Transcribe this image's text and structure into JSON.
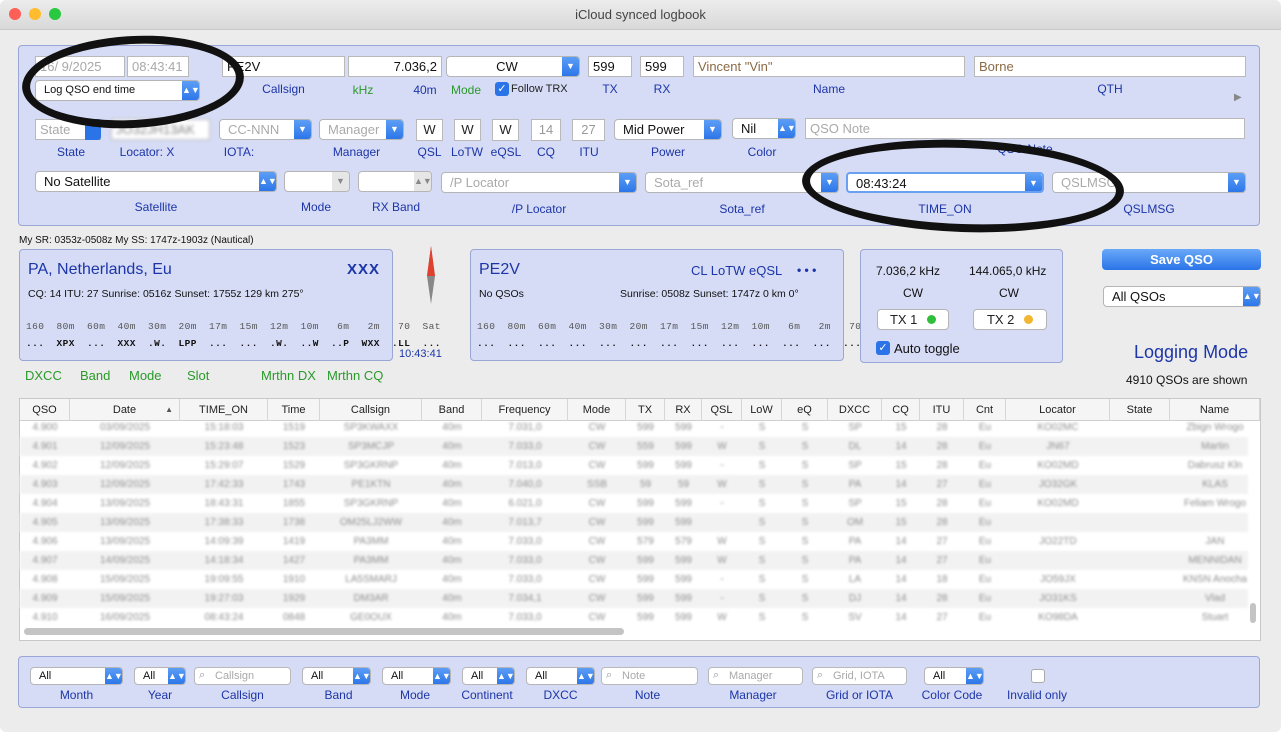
{
  "window": {
    "title": "iCloud synced logbook"
  },
  "entry": {
    "date": "16/ 9/2025",
    "time": "08:43:41",
    "log_end_time": "Log QSO end time",
    "callsign": "PE2V",
    "callsign_label": "Callsign",
    "frequency": "7.036,2",
    "khz_label": "kHz",
    "band_label": "40m",
    "mode": "CW",
    "mode_label": "Mode",
    "follow_trx": "Follow TRX",
    "tx_rst": "599",
    "tx_label": "TX",
    "rx_rst": "599",
    "rx_label": "RX",
    "name": "Vincent \"Vin\"",
    "name_label": "Name",
    "qth": "Borne",
    "qth_label": "QTH",
    "state_placeholder": "State",
    "state_label": "State",
    "locator": "JO32JH13AK",
    "locator_label": "Locator: X",
    "iota_placeholder": "CC-NNN",
    "iota_label": "IOTA:",
    "manager_placeholder": "Manager",
    "manager_label": "Manager",
    "qsl": "W",
    "qsl_label": "QSL",
    "lotw": "W",
    "lotw_label": "LoTW",
    "eqsl": "W",
    "eqsl_label": "eQSL",
    "cq": "14",
    "cq_label": "CQ",
    "itu": "27",
    "itu_label": "ITU",
    "power": "Mid Power",
    "power_label": "Power",
    "color": "Nil",
    "color_label": "Color",
    "qso_note_placeholder": "QSO Note",
    "qso_note_label": "QSO Note",
    "satellite": "No Satellite",
    "satellite_label": "Satellite",
    "sat_mode_label": "Mode",
    "rx_band_label": "RX Band",
    "p_locator_placeholder": "/P Locator",
    "p_locator_label": "/P Locator",
    "sota_placeholder": "Sota_ref",
    "sota_label": "Sota_ref",
    "time_on": "08:43:24",
    "time_on_label": "TIME_ON",
    "qslmsg_placeholder": "QSLMSG",
    "qslmsg_label": "QSLMSG"
  },
  "sun": "My SR: 0353z-0508z  My SS: 1747z-1903z (Nautical)",
  "dxcc_card": {
    "entity": "PA, Netherlands, Eu",
    "flags": "XXX",
    "info": "CQ: 14  ITU: 27  Sunrise: 0516z  Sunset: 1755z  129 km  275°",
    "bands": "160  80m  60m  40m  30m  20m  17m  15m  12m  10m   6m   2m   70  Sat",
    "status": "...  XPX  ...  XXX  .W.  LPP  ...  ...  .W.  ..W  ..P  WXX  .LL  ..."
  },
  "clock": "10:43:41",
  "call_card": {
    "callsign": "PE2V",
    "services": "CL LoTW eQSL",
    "dots": "• • •",
    "qsos": "No QSOs",
    "info": "Sunrise: 0508z  Sunset: 1747z  0 km  0°",
    "bands": "160  80m  60m  40m  30m  20m  17m  15m  12m  10m   6m   2m   70  Sat",
    "status": "...  ...  ...  ...  ...  ...  ...  ...  ...  ...  ...  ...  ...  ..."
  },
  "links": [
    "DXCC",
    "Band",
    "Mode",
    "Slot",
    "Mrthn DX",
    "Mrthn CQ"
  ],
  "trx": {
    "tx1_freq": "7.036,2 kHz",
    "tx2_freq": "144.065,0 kHz",
    "tx1_mode": "CW",
    "tx2_mode": "CW",
    "tx1": "TX 1",
    "tx2": "TX 2",
    "auto_toggle": "Auto toggle"
  },
  "save": "Save QSO",
  "filter_view": "All QSOs",
  "logging_mode": "Logging Mode",
  "count": "4910 QSOs are shown",
  "table": {
    "headers": [
      "QSO",
      "Date",
      "TIME_ON",
      "Time",
      "Callsign",
      "Band",
      "Frequency",
      "Mode",
      "TX",
      "RX",
      "QSL",
      "LoW",
      "eQ",
      "DXCC",
      "CQ",
      "ITU",
      "Cnt",
      "Locator",
      "State",
      "Name"
    ],
    "rows": [
      [
        "4.900",
        "03/09/2025",
        "15:18:03",
        "1519",
        "SP3KWAXX",
        "40m",
        "7.031,0",
        "CW",
        "599",
        "599",
        "-",
        "S",
        "S",
        "SP",
        "15",
        "28",
        "Eu",
        "KO02MC",
        "",
        "Zbign Wrogo"
      ],
      [
        "4.901",
        "12/09/2025",
        "15:23:48",
        "1523",
        "SP3MCJP",
        "40m",
        "7.033,0",
        "CW",
        "559",
        "599",
        "W",
        "S",
        "S",
        "DL",
        "14",
        "28",
        "Eu",
        "JN67",
        "",
        "Martin"
      ],
      [
        "4.902",
        "12/09/2025",
        "15:29:07",
        "1529",
        "SP3GKRNP",
        "40m",
        "7.013,0",
        "CW",
        "599",
        "599",
        "-",
        "S",
        "S",
        "SP",
        "15",
        "28",
        "Eu",
        "KO02MD",
        "",
        "Dabrusz Kln"
      ],
      [
        "4.903",
        "12/09/2025",
        "17:42:33",
        "1743",
        "PE1KTN",
        "40m",
        "7.040,0",
        "SSB",
        "59",
        "59",
        "W",
        "S",
        "S",
        "PA",
        "14",
        "27",
        "Eu",
        "JO32GK",
        "",
        "KLAS"
      ],
      [
        "4.904",
        "13/09/2025",
        "18:43:31",
        "1855",
        "SP3GKRNP",
        "40m",
        "6.021,0",
        "CW",
        "599",
        "599",
        "-",
        "S",
        "S",
        "SP",
        "15",
        "28",
        "Eu",
        "KO02MD",
        "",
        "Feliam Wrogo"
      ],
      [
        "4.905",
        "13/09/2025",
        "17:38:33",
        "1738",
        "OM25LJ2WW",
        "40m",
        "7.013,7",
        "CW",
        "599",
        "599",
        "",
        "S",
        "S",
        "OM",
        "15",
        "28",
        "Eu",
        "",
        "",
        ""
      ],
      [
        "4.906",
        "13/09/2025",
        "14:09:39",
        "1419",
        "PA3MM",
        "40m",
        "7.033,0",
        "CW",
        "579",
        "579",
        "W",
        "S",
        "S",
        "PA",
        "14",
        "27",
        "Eu",
        "JO22TD",
        "",
        "JAN"
      ],
      [
        "4.907",
        "14/09/2025",
        "14:18:34",
        "1427",
        "PA3MM",
        "40m",
        "7.033,0",
        "CW",
        "599",
        "599",
        "W",
        "S",
        "S",
        "PA",
        "14",
        "27",
        "Eu",
        "",
        "",
        "MENNIDAN"
      ],
      [
        "4.908",
        "15/09/2025",
        "19:09:55",
        "1910",
        "LA5SMARJ",
        "40m",
        "7.033,0",
        "CW",
        "599",
        "599",
        "-",
        "S",
        "S",
        "LA",
        "14",
        "18",
        "Eu",
        "JO59JX",
        "",
        "KNSN Anocha"
      ],
      [
        "4.909",
        "15/09/2025",
        "19:27:03",
        "1929",
        "DM3AR",
        "40m",
        "7.034,1",
        "CW",
        "599",
        "599",
        "-",
        "S",
        "S",
        "DJ",
        "14",
        "28",
        "Eu",
        "JO31KS",
        "",
        "Vlad"
      ],
      [
        "4.910",
        "16/09/2025",
        "08:43:24",
        "0848",
        "GE0OUX",
        "40m",
        "7.033,0",
        "CW",
        "599",
        "599",
        "W",
        "S",
        "S",
        "SV",
        "14",
        "27",
        "Eu",
        "KO98DA",
        "",
        "Stuart"
      ]
    ]
  },
  "filters": {
    "month": "All",
    "month_label": "Month",
    "year": "All",
    "year_label": "Year",
    "callsign_placeholder": "Callsign",
    "callsign_label": "Callsign",
    "band": "All",
    "band_label": "Band",
    "mode": "All",
    "mode_label": "Mode",
    "continent": "All",
    "continent_label": "Continent",
    "dxcc": "All",
    "dxcc_label": "DXCC",
    "note_placeholder": "Note",
    "note_label": "Note",
    "manager_placeholder": "Manager",
    "manager_label": "Manager",
    "grid_placeholder": "Grid, IOTA",
    "grid_label": "Grid or IOTA",
    "color": "All",
    "color_label": "Color Code",
    "invalid_label": "Invalid only"
  },
  "colors": {
    "accent": "#2a74e8",
    "label_blue": "#1c35a8",
    "label_green": "#2a9a2a",
    "panel": "#d6dcf5",
    "tx1_dot": "#2fbf3a",
    "tx2_dot": "#f2b630"
  }
}
